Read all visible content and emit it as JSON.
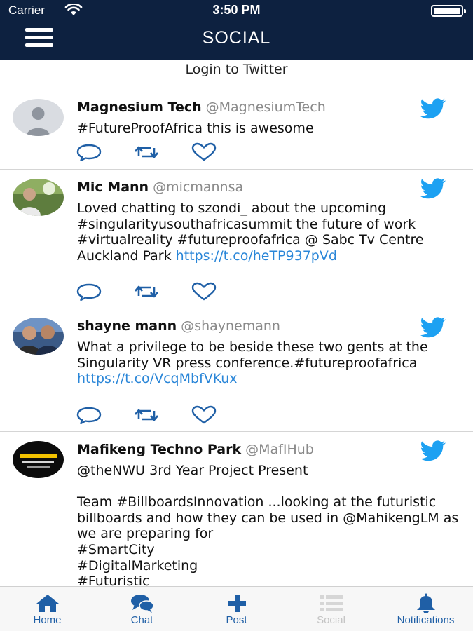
{
  "status": {
    "carrier": "Carrier",
    "time": "3:50 PM"
  },
  "nav": {
    "title": "SOCIAL"
  },
  "login_link": "Login to Twitter",
  "tweets": [
    {
      "name": "Magnesium Tech",
      "handle": "@MagnesiumTech",
      "text": "#FutureProofAfrica this is awesome",
      "link": ""
    },
    {
      "name": "Mic Mann",
      "handle": "@micmannsa",
      "text": "Loved chatting to szondi_ about the upcoming #singularityusouthafricasummit the future of work #virtualreality #futureproofafrica @ Sabc Tv Centre Auckland Park ",
      "link": "https://t.co/heTP937pVd"
    },
    {
      "name": "shayne mann",
      "handle": "@shaynemann",
      "text": "What a privilege to be beside these two gents at the Singularity VR press conference.#futureproofafrica ",
      "link": "https://t.co/VcqMbfVKux"
    },
    {
      "name": "Mafikeng Techno Park",
      "handle": "@MafIHub",
      "text": "@theNWU 3rd Year Project Present\n\nTeam #BillboardsInnovation ...looking at the futuristic billboards and how they can be used in @MahikengLM as we are preparing for\n#SmartCity\n#DigitalMarketing\n#Futuristic",
      "link": ""
    }
  ],
  "tabs": [
    {
      "label": "Home",
      "icon": "home-icon"
    },
    {
      "label": "Chat",
      "icon": "chat-bubbles-icon"
    },
    {
      "label": "Post",
      "icon": "plus-icon"
    },
    {
      "label": "Social",
      "icon": "list-icon"
    },
    {
      "label": "Notifications",
      "icon": "bell-icon"
    }
  ],
  "colors": {
    "navbar": "#0d2140",
    "accent": "#1f5fa6",
    "twitter": "#1da1f2",
    "link": "#2a86d8"
  }
}
